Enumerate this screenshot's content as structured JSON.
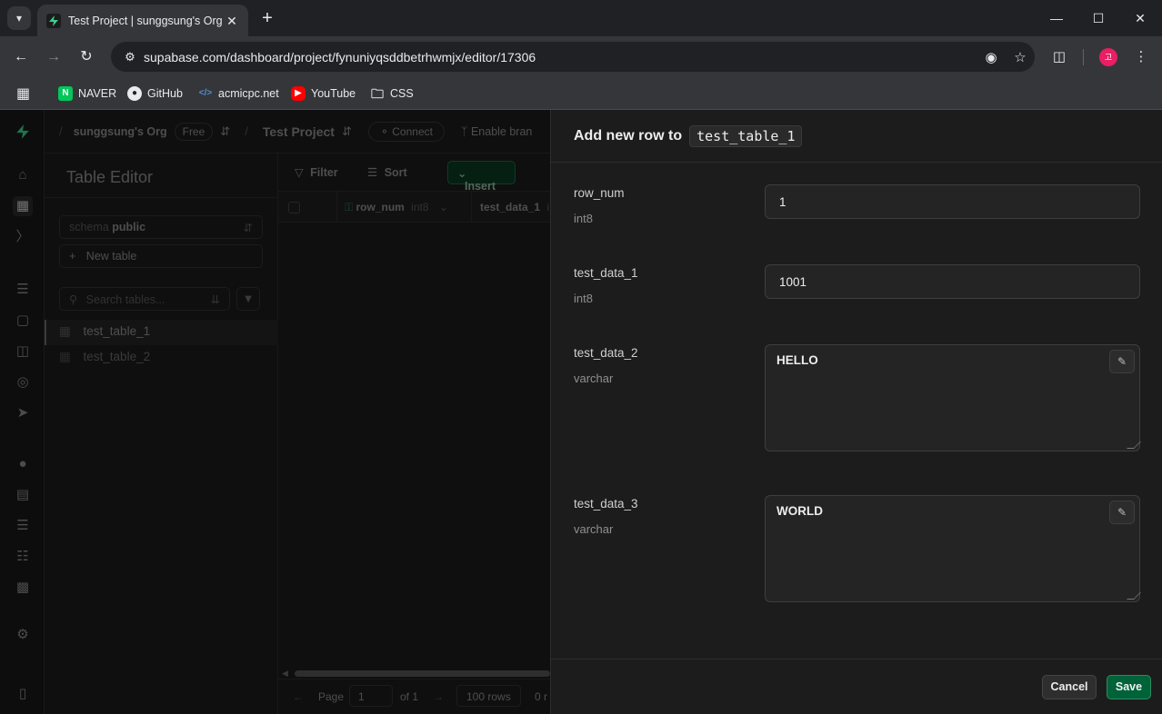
{
  "browser": {
    "tab_title": "Test Project | sunggsung's Org",
    "url": "supabase.com/dashboard/project/fynuniyqsddbetrhwmjx/editor/17306",
    "profile_initial": "고",
    "bookmarks": [
      {
        "label": "NAVER"
      },
      {
        "label": "GitHub"
      },
      {
        "label": "acmicpc.net"
      },
      {
        "label": "YouTube"
      },
      {
        "label": "CSS"
      }
    ]
  },
  "topbar": {
    "org": "sunggsung's Org",
    "plan": "Free",
    "project": "Test Project",
    "connect": "Connect",
    "branching": "Enable bran"
  },
  "side_panel": {
    "title": "Table Editor",
    "schema_label": "schema",
    "schema_value": "public",
    "new_table": "New table",
    "search_placeholder": "Search tables...",
    "tables": [
      "test_table_1",
      "test_table_2"
    ]
  },
  "grid": {
    "filter": "Filter",
    "sort": "Sort",
    "insert": "Insert",
    "columns": [
      {
        "name": "row_num",
        "type": "int8"
      },
      {
        "name": "test_data_1",
        "type": "i"
      }
    ],
    "pager": {
      "page_label": "Page",
      "page_value": "1",
      "of": "of 1",
      "rows": "100 rows",
      "records": "0 r"
    }
  },
  "sheet": {
    "title": "Add new row to",
    "table": "test_table_1",
    "fields": [
      {
        "name": "row_num",
        "type": "int8",
        "value": "1"
      },
      {
        "name": "test_data_1",
        "type": "int8",
        "value": "1001"
      },
      {
        "name": "test_data_2",
        "type": "varchar",
        "value": "HELLO"
      },
      {
        "name": "test_data_3",
        "type": "varchar",
        "value": "WORLD"
      }
    ],
    "cancel": "Cancel",
    "save": "Save"
  },
  "colors": {
    "accent": "#3ecf8e",
    "save_bg": "#006239",
    "background": "#1c1c1c"
  }
}
